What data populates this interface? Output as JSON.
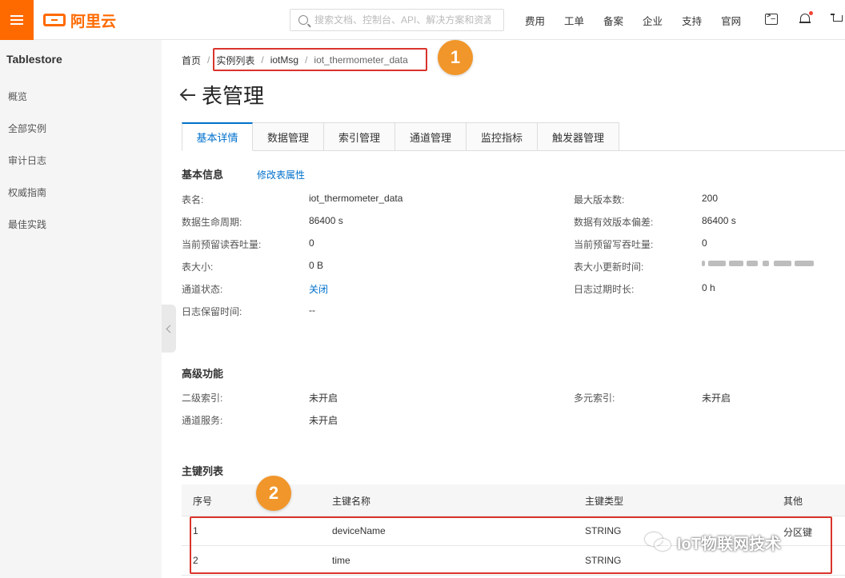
{
  "topbar": {
    "logo_text": "阿里云",
    "search_placeholder": "搜索文档、控制台、API、解决方案和资源",
    "nav": [
      "费用",
      "工单",
      "备案",
      "企业",
      "支持",
      "官网"
    ]
  },
  "sidebar": {
    "title": "Tablestore",
    "items": [
      "概览",
      "全部实例",
      "审计日志",
      "权威指南",
      "最佳实践"
    ]
  },
  "breadcrumb": [
    "首页",
    "实例列表",
    "iotMsg",
    "iot_thermometer_data"
  ],
  "markers": [
    "1",
    "2"
  ],
  "page": {
    "title": "表管理",
    "tabs": [
      "基本详情",
      "数据管理",
      "索引管理",
      "通道管理",
      "监控指标",
      "触发器管理"
    ]
  },
  "basic": {
    "title": "基本信息",
    "edit_link": "修改表属性",
    "left": [
      {
        "label": "表名:",
        "value": "iot_thermometer_data"
      },
      {
        "label": "数据生命周期:",
        "value": "86400 s"
      },
      {
        "label": "当前预留读吞吐量:",
        "value": "0"
      },
      {
        "label": "表大小:",
        "value": "0 B"
      },
      {
        "label": "通道状态:",
        "value": "关闭"
      },
      {
        "label": "日志保留时间:",
        "value": "--"
      }
    ],
    "right": [
      {
        "label": "最大版本数:",
        "value": "200"
      },
      {
        "label": "数据有效版本偏差:",
        "value": "86400 s"
      },
      {
        "label": "当前预留写吞吐量:",
        "value": "0"
      },
      {
        "label": "表大小更新时间:",
        "value": ""
      },
      {
        "label": "日志过期时长:",
        "value": "0 h"
      }
    ]
  },
  "advanced": {
    "title": "高级功能",
    "items": [
      {
        "label": "二级索引:",
        "value": "未开启"
      },
      {
        "label": "多元索引:",
        "value": "未开启"
      },
      {
        "label": "通道服务:",
        "value": "未开启"
      }
    ]
  },
  "pk": {
    "title": "主键列表",
    "columns": [
      "序号",
      "主键名称",
      "主键类型",
      "其他"
    ],
    "rows": [
      {
        "no": "1",
        "name": "deviceName",
        "type": "STRING",
        "other": "分区键"
      },
      {
        "no": "2",
        "name": "time",
        "type": "STRING",
        "other": ""
      }
    ]
  },
  "watermark": "IoT物联网技术",
  "colors": {
    "accent": "#ff6a00",
    "link": "#0070cc",
    "highlight": "#d9342b",
    "marker": "#f1962a"
  }
}
